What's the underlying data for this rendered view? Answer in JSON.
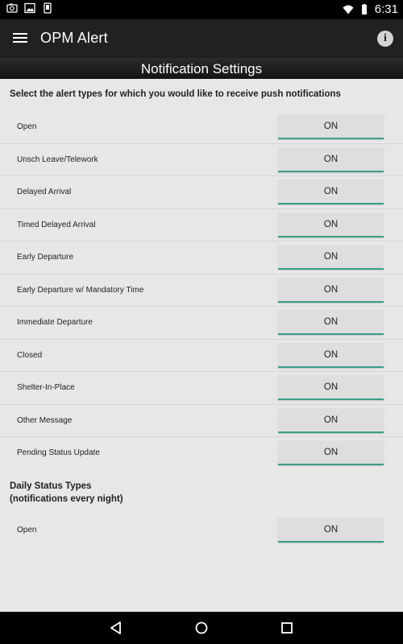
{
  "status_bar": {
    "time": "6:31",
    "left_icons": [
      "camera-icon",
      "image-icon",
      "sim-card-icon"
    ],
    "right_icons": [
      "wifi-icon",
      "battery-icon"
    ]
  },
  "app_bar": {
    "title": "OPM Alert",
    "menu_icon": "menu-icon",
    "info_icon": "info-icon",
    "info_glyph": "i"
  },
  "section_header": "Notification Settings",
  "instructions": "Select the alert types for which you would like to receive push notifications",
  "alerts": [
    {
      "label": "Open",
      "state": "ON"
    },
    {
      "label": "Unsch Leave/Telework",
      "state": "ON"
    },
    {
      "label": "Delayed Arrival",
      "state": "ON"
    },
    {
      "label": "Timed Delayed Arrival",
      "state": "ON"
    },
    {
      "label": "Early Departure",
      "state": "ON"
    },
    {
      "label": "Early Departure w/ Mandatory Time",
      "state": "ON"
    },
    {
      "label": "Immediate Departure",
      "state": "ON"
    },
    {
      "label": "Closed",
      "state": "ON"
    },
    {
      "label": "Shelter-In-Place",
      "state": "ON"
    },
    {
      "label": "Other Message",
      "state": "ON"
    },
    {
      "label": "Pending Status Update",
      "state": "ON"
    }
  ],
  "daily": {
    "title_line1": "Daily Status Types",
    "title_line2": "(notifications every night)",
    "items": [
      {
        "label": "Open",
        "state": "ON"
      }
    ]
  },
  "colors": {
    "accent": "#3a9e8a",
    "app_bar": "#212121",
    "background": "#e7e7e7"
  }
}
